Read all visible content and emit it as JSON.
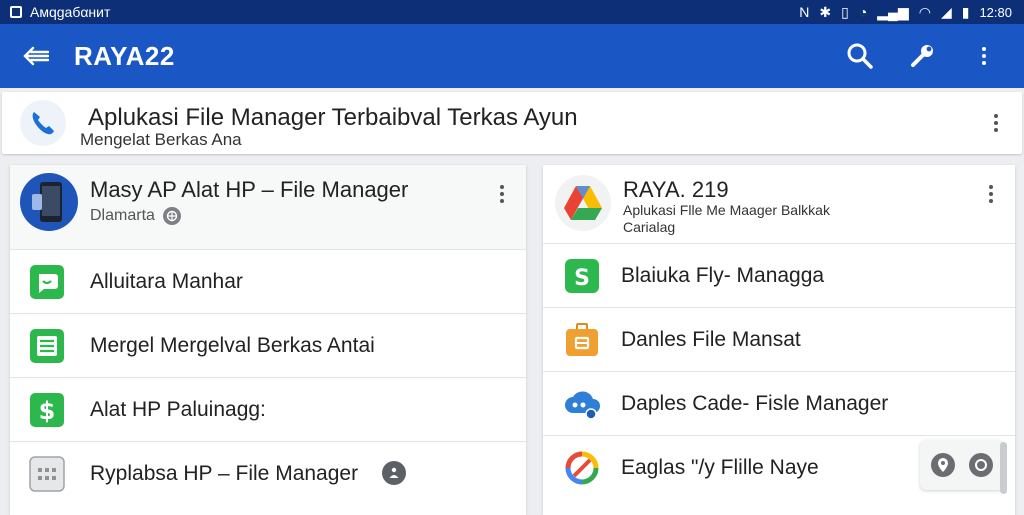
{
  "status_bar": {
    "app_name": "Aмqgaбαнит",
    "time": "12:80"
  },
  "app_bar": {
    "title": "RAYA22"
  },
  "banner": {
    "title": "Aplukasi File Manager Terbaibval Terkas Ayun",
    "subtitle": "Mengelat Berkas Ana"
  },
  "left_card": {
    "title": "Masy AP  Alat HP – File Manager",
    "subtitle": "Dlamarta",
    "items": [
      {
        "label": "Alluitara Manhar",
        "icon": "chat-icon",
        "color": "#2db84d"
      },
      {
        "label": "Mergel Mergelval Berkas Antai",
        "icon": "list-icon",
        "color": "#2db84d"
      },
      {
        "label": "Alat HP Paluinagg:",
        "icon": "dollar-icon",
        "color": "#2db84d"
      },
      {
        "label": "Ryplabsa HP – File Manager",
        "icon": "grid-icon",
        "color": "#8e9296"
      }
    ]
  },
  "right_card": {
    "title": "RAYA. 219",
    "subtitle_line1": "Aplukasi Flle Me Maager Balkkak",
    "subtitle_line2": "Carialag",
    "items": [
      {
        "label": "Blaiuka Fly- Managga",
        "icon": "money-icon",
        "color": "#2db84d"
      },
      {
        "label": "Danles File Mansat",
        "icon": "briefcase-icon",
        "color": "#f0a030"
      },
      {
        "label": "Daples Cade- Fisle Manager",
        "icon": "cloud-icon",
        "color": "#2f7ed8"
      },
      {
        "label": "Eaglas \"/y Flille Naye",
        "icon": "circle-arrows-icon",
        "color": "#e8493a"
      }
    ]
  },
  "colors": {
    "status_bar": "#0d2f78",
    "app_bar": "#1a57c4",
    "accent_green": "#2db84d"
  }
}
